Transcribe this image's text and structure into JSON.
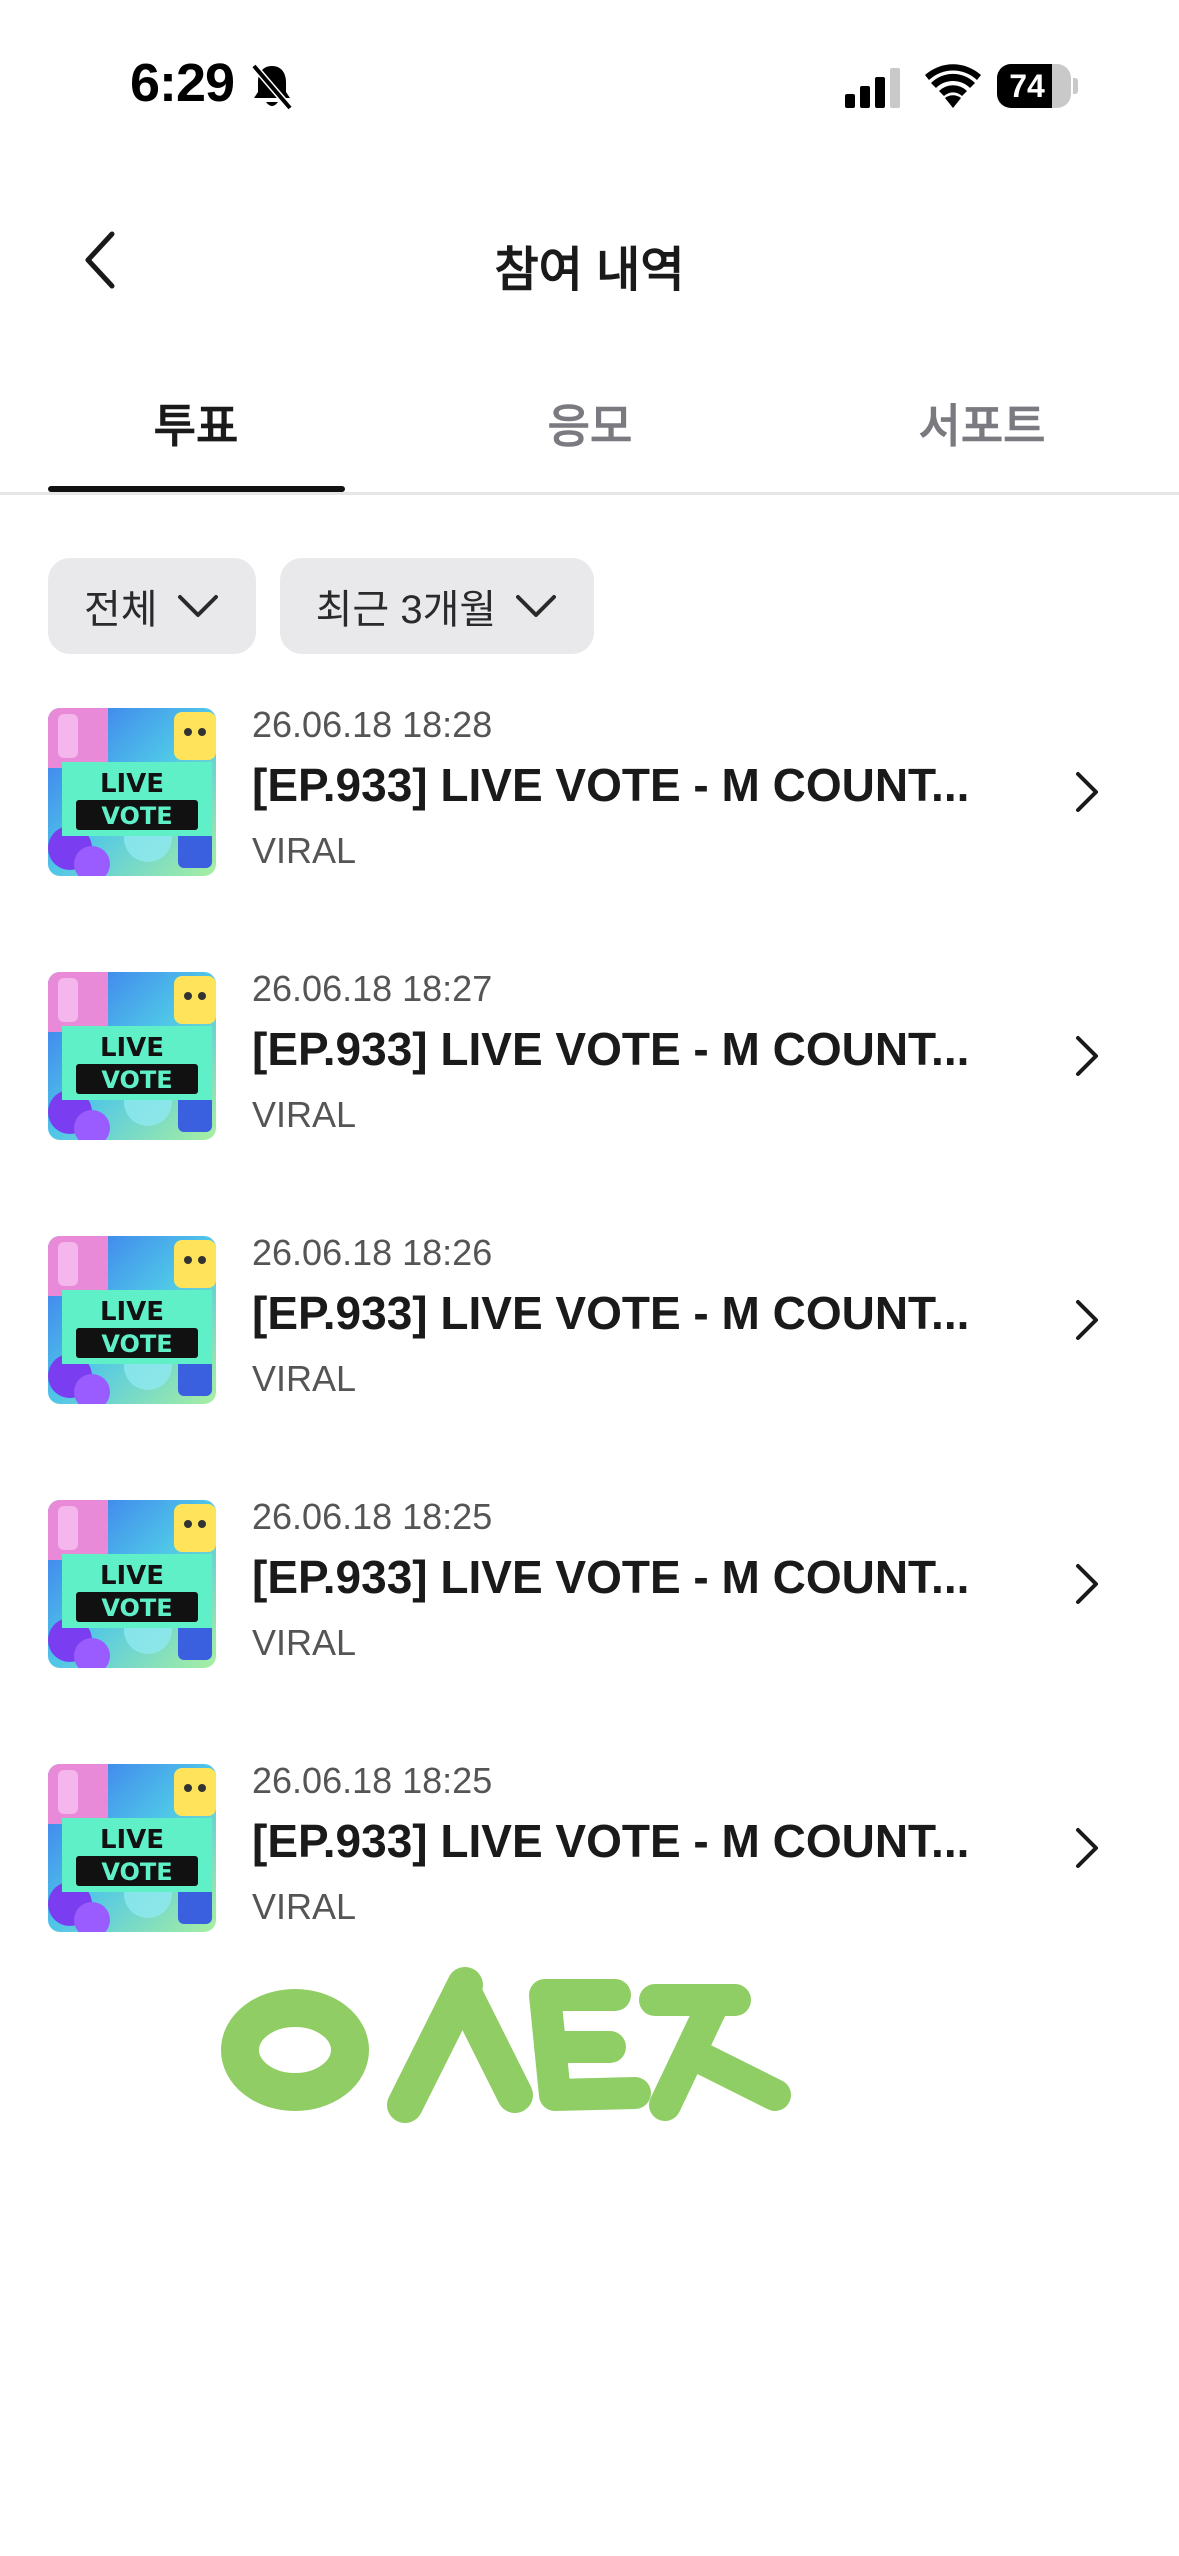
{
  "status_bar": {
    "time": "6:29",
    "battery": "74",
    "battery_level": 0.74,
    "icons": [
      "bell-slash-icon",
      "signal-icon",
      "wifi-icon",
      "battery-icon"
    ]
  },
  "header": {
    "title": "참여 내역",
    "back_icon": "chevron-left-icon"
  },
  "tabs": [
    {
      "label": "투표",
      "active": true
    },
    {
      "label": "응모",
      "active": false
    },
    {
      "label": "서포트",
      "active": false
    }
  ],
  "filters": [
    {
      "label": "전체",
      "icon": "chevron-down-icon"
    },
    {
      "label": "최근 3개월",
      "icon": "chevron-down-icon"
    }
  ],
  "items": [
    {
      "date": "26.06.18 18:28",
      "title": "[EP.933] LIVE VOTE - M COUNT...",
      "subtitle": "VIRAL",
      "thumb_line1": "LIVE",
      "thumb_line2": "VOTE"
    },
    {
      "date": "26.06.18 18:27",
      "title": "[EP.933] LIVE VOTE - M COUNT...",
      "subtitle": "VIRAL",
      "thumb_line1": "LIVE",
      "thumb_line2": "VOTE"
    },
    {
      "date": "26.06.18 18:26",
      "title": "[EP.933] LIVE VOTE - M COUNT...",
      "subtitle": "VIRAL",
      "thumb_line1": "LIVE",
      "thumb_line2": "VOTE"
    },
    {
      "date": "26.06.18 18:25",
      "title": "[EP.933] LIVE VOTE - M COUNT...",
      "subtitle": "VIRAL",
      "thumb_line1": "LIVE",
      "thumb_line2": "VOTE"
    },
    {
      "date": "26.06.18 18:25",
      "title": "[EP.933] LIVE VOTE - M COUNT...",
      "subtitle": "VIRAL",
      "thumb_line1": "LIVE",
      "thumb_line2": "VOTE"
    }
  ],
  "watermark": {
    "text": "ㅇㅅㅌㅈ",
    "color": "#7cc64a"
  },
  "colors": {
    "text_primary": "#1a1a1a",
    "text_secondary": "#555555",
    "tab_inactive": "#7a7a80",
    "chip_bg": "#e9e9ec",
    "indicator": "#111111"
  }
}
